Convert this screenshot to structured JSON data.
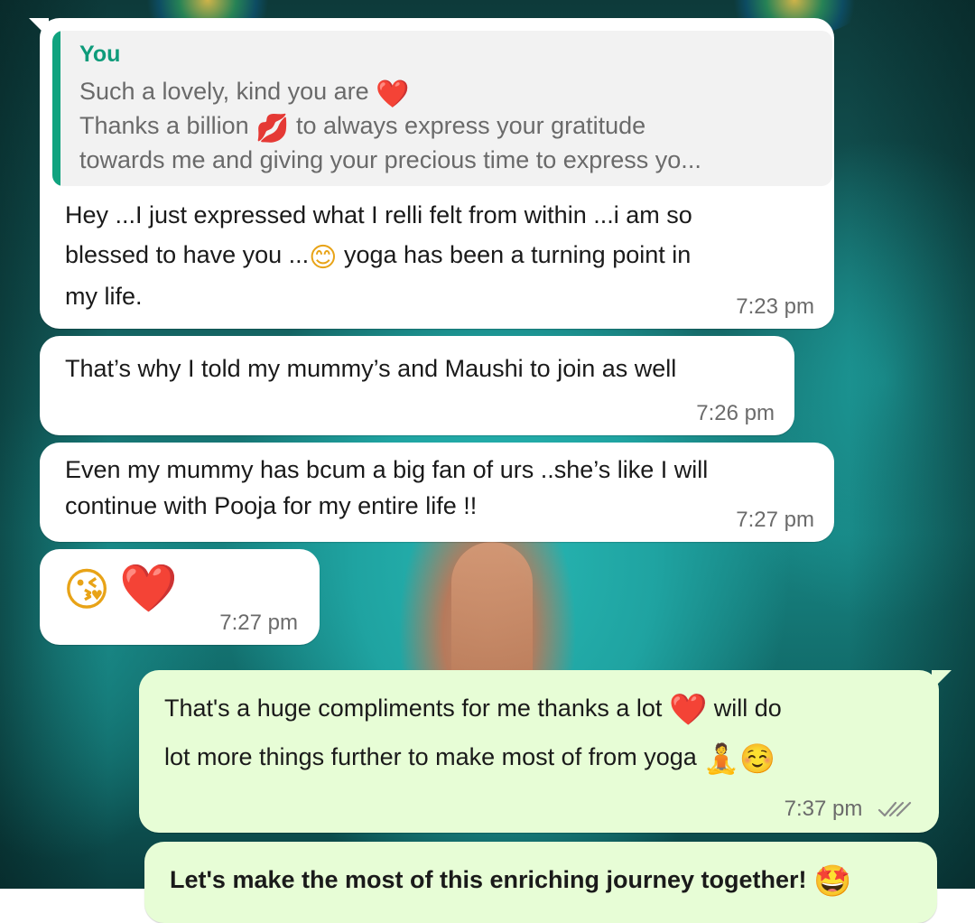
{
  "conversation": {
    "quoted": {
      "author": "You",
      "lines": [
        "Such a lovely, kind you are",
        "Thanks a billion",
        "to always express your gratitude",
        "towards me and giving your precious time to express yo..."
      ],
      "emojis": [
        "❤️",
        "💋"
      ]
    },
    "messages": [
      {
        "direction": "incoming",
        "lines": [
          "Hey ...I just expressed what I relli felt from within ...i am so",
          "blessed to have you ...",
          "yoga has been a turning point in",
          "my life."
        ],
        "emoji": "😊",
        "time": "7:23 pm"
      },
      {
        "direction": "incoming",
        "lines": [
          "That’s why I told my mummy’s and Maushi to join as well"
        ],
        "time": "7:26 pm"
      },
      {
        "direction": "incoming",
        "lines": [
          "Even my mummy has bcum a big fan of urs ..she’s like I will",
          "continue with Pooja for my entire life !!"
        ],
        "time": "7:27 pm"
      },
      {
        "direction": "incoming",
        "emojis": [
          "😘",
          "❤️"
        ],
        "time": "7:27 pm"
      },
      {
        "direction": "outgoing",
        "lines": [
          "That's a huge compliments for me thanks a lot",
          "will do",
          "lot more things further to make most of from yoga"
        ],
        "emojis": [
          "❤️",
          "🧘",
          "☺️"
        ],
        "time": "7:37 pm",
        "status_icon": "double-check-icon"
      },
      {
        "direction": "outgoing",
        "lines": [
          "Let's make the most of this enriching journey together!"
        ],
        "emoji": "🤩"
      }
    ]
  },
  "colors": {
    "incoming_bubble": "#ffffff",
    "outgoing_bubble": "#e7fdd6",
    "quote_bar": "#10a37f",
    "quote_author": "#0e9b7a",
    "timestamp": "#6b6b6b",
    "heart": "#e0202f"
  }
}
